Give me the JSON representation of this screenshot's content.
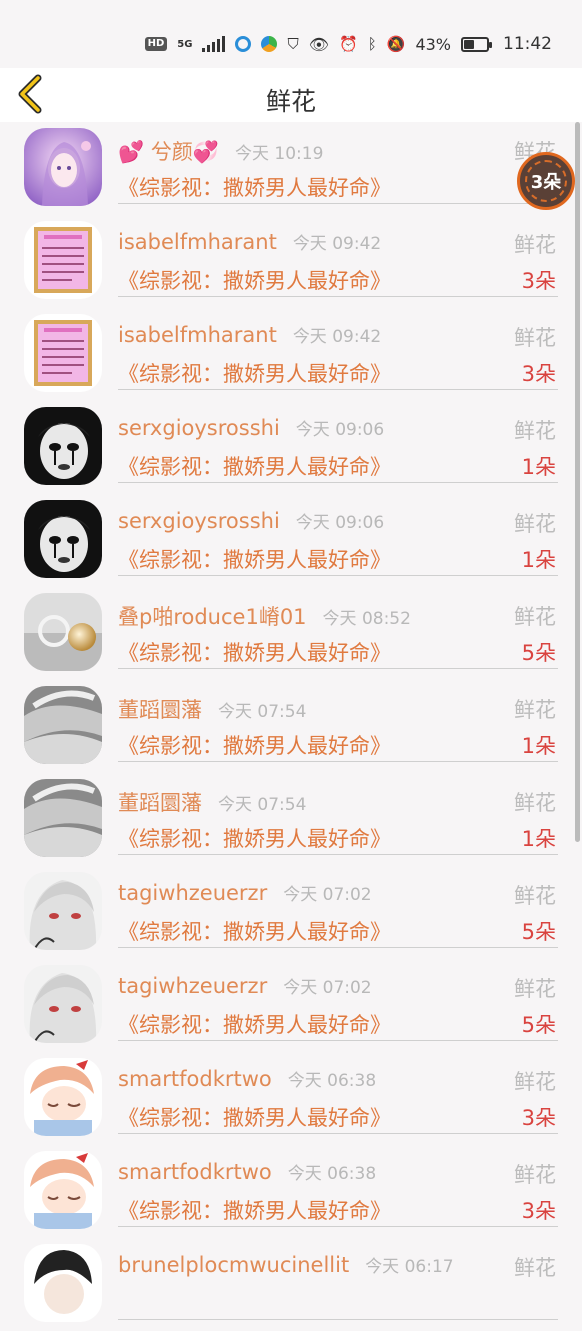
{
  "status_bar": {
    "battery_percent": "43%",
    "time": "11:42",
    "hd_badge": "HD",
    "net_type": "5G"
  },
  "header": {
    "title": "鲜花"
  },
  "floating_badge": {
    "text": "3朵"
  },
  "list": [
    {
      "name": "💕 兮颜💞",
      "time": "今天 10:19",
      "label": "鲜花",
      "book": "《综影视：撒娇男人最好命》",
      "count": "3朵",
      "avatar": "girl-purple"
    },
    {
      "name": "isabelfmharant",
      "time": "今天 09:42",
      "label": "鲜花",
      "book": "《综影视：撒娇男人最好命》",
      "count": "3朵",
      "avatar": "pink-frame"
    },
    {
      "name": "isabelfmharant",
      "time": "今天 09:42",
      "label": "鲜花",
      "book": "《综影视：撒娇男人最好命》",
      "count": "3朵",
      "avatar": "pink-frame"
    },
    {
      "name": "serxgioysrosshi",
      "time": "今天 09:06",
      "label": "鲜花",
      "book": "《综影视：撒娇男人最好命》",
      "count": "1朵",
      "avatar": "mime"
    },
    {
      "name": "serxgioysrosshi",
      "time": "今天 09:06",
      "label": "鲜花",
      "book": "《综影视：撒娇男人最好命》",
      "count": "1朵",
      "avatar": "mime"
    },
    {
      "name": "叠p啪roduce1嵴01",
      "time": "今天 08:52",
      "label": "鲜花",
      "book": "《综影视：撒娇男人最好命》",
      "count": "5朵",
      "avatar": "pearl"
    },
    {
      "name": "董蹈圜藩",
      "time": "今天 07:54",
      "label": "鲜花",
      "book": "《综影视：撒娇男人最好命》",
      "count": "1朵",
      "avatar": "fabric"
    },
    {
      "name": "董蹈圜藩",
      "time": "今天 07:54",
      "label": "鲜花",
      "book": "《综影视：撒娇男人最好命》",
      "count": "1朵",
      "avatar": "fabric"
    },
    {
      "name": "tagiwhzeuerzr",
      "time": "今天 07:02",
      "label": "鲜花",
      "book": "《综影视：撒娇男人最好命》",
      "count": "5朵",
      "avatar": "anime-white"
    },
    {
      "name": "tagiwhzeuerzr",
      "time": "今天 07:02",
      "label": "鲜花",
      "book": "《综影视：撒娇男人最好命》",
      "count": "5朵",
      "avatar": "anime-white"
    },
    {
      "name": "smartfodkrtwo",
      "time": "今天 06:38",
      "label": "鲜花",
      "book": "《综影视：撒娇男人最好命》",
      "count": "3朵",
      "avatar": "anime-sleep"
    },
    {
      "name": "smartfodkrtwo",
      "time": "今天 06:38",
      "label": "鲜花",
      "book": "《综影视：撒娇男人最好命》",
      "count": "3朵",
      "avatar": "anime-sleep"
    },
    {
      "name": "brunelplocmwucinellit",
      "time": "今天 06:17",
      "label": "鲜花",
      "book": "",
      "count": "",
      "avatar": "anime-dark"
    }
  ]
}
